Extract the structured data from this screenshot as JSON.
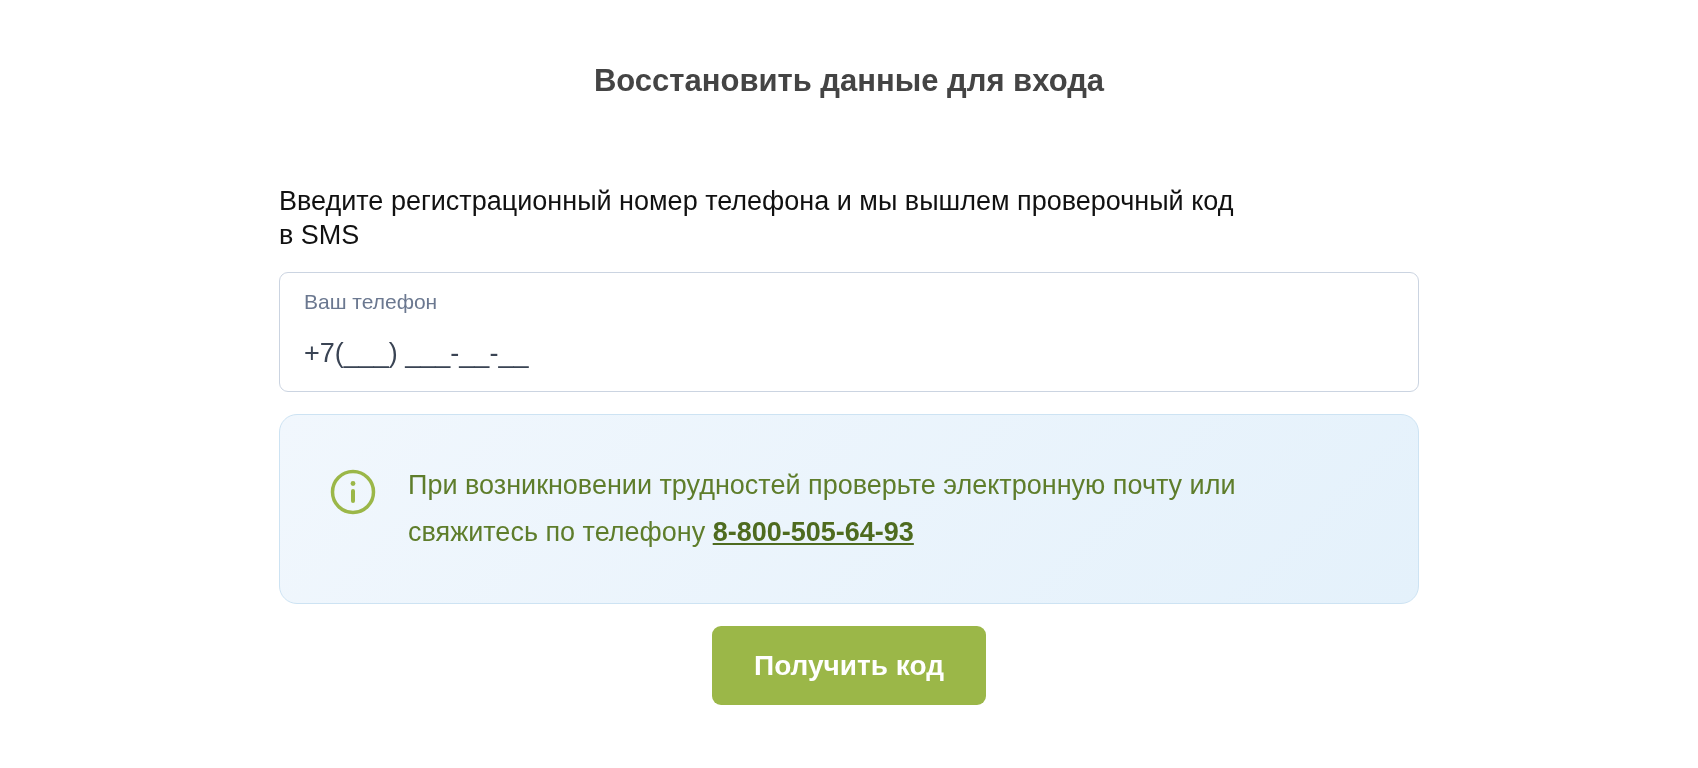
{
  "title": "Восстановить данные для входа",
  "instruction": "Введите регистрационный номер телефона и мы вышлем проверочный код в SMS",
  "phone_field": {
    "label": "Ваш телефон",
    "value": "+7(___) ___-__-__"
  },
  "notice": {
    "text": "При возникновении трудностей проверьте электронную почту или свяжитесь по телефону",
    "phone_link": "8-800-505-64-93"
  },
  "submit_button": {
    "label": "Получить код"
  }
}
